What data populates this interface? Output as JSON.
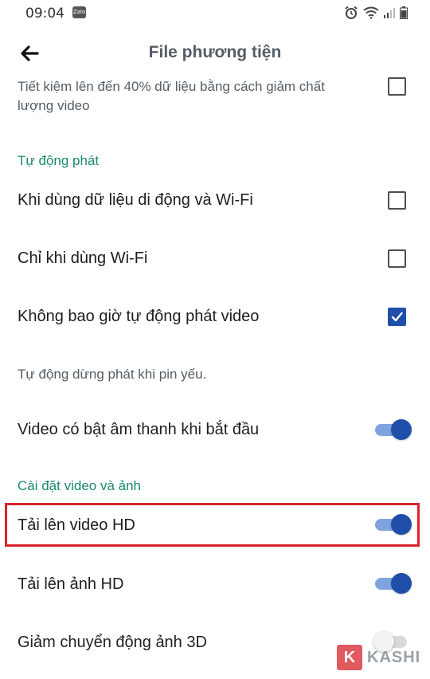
{
  "status": {
    "time": "09:04",
    "notification_badge": "Zalo"
  },
  "appbar": {
    "title": "File phương tiện"
  },
  "rows": {
    "data_saver_desc": "Tiết kiệm lên đến 40% dữ liệu bằng cách giảm chất lượng video",
    "autoplay_header": "Tự động phát",
    "mobile_wifi_label": "Khi dùng dữ liệu di động và Wi-Fi",
    "wifi_only_label": "Chỉ khi dùng Wi-Fi",
    "never_autoplay_label": "Không bao giờ tự động phát video",
    "low_battery_note": "Tự động dừng phát khi pin yếu.",
    "video_sound_label": "Video có bật âm thanh khi bắt đầu",
    "video_photo_header": "Cài đặt video và ảnh",
    "upload_hd_video_label": "Tải lên video HD",
    "upload_hd_photo_label": "Tải lên ảnh HD",
    "reduce_3d_motion_label": "Giảm chuyển động ảnh 3D"
  },
  "states": {
    "data_saver_checked": false,
    "mobile_wifi_checked": false,
    "wifi_only_checked": false,
    "never_autoplay_checked": true,
    "video_sound_on": true,
    "upload_hd_video_on": true,
    "upload_hd_photo_on": true,
    "reduce_3d_motion_on": false
  },
  "watermark": {
    "letter": "K",
    "text": "KASHI"
  },
  "colors": {
    "accent": "#1f4fa8",
    "section_header": "#1a8a6b",
    "highlight": "#d9232d"
  },
  "icons": {
    "back": "arrow-left",
    "alarm": "alarm-clock",
    "wifi": "wifi",
    "signal": "cellular-signal",
    "battery": "battery"
  }
}
